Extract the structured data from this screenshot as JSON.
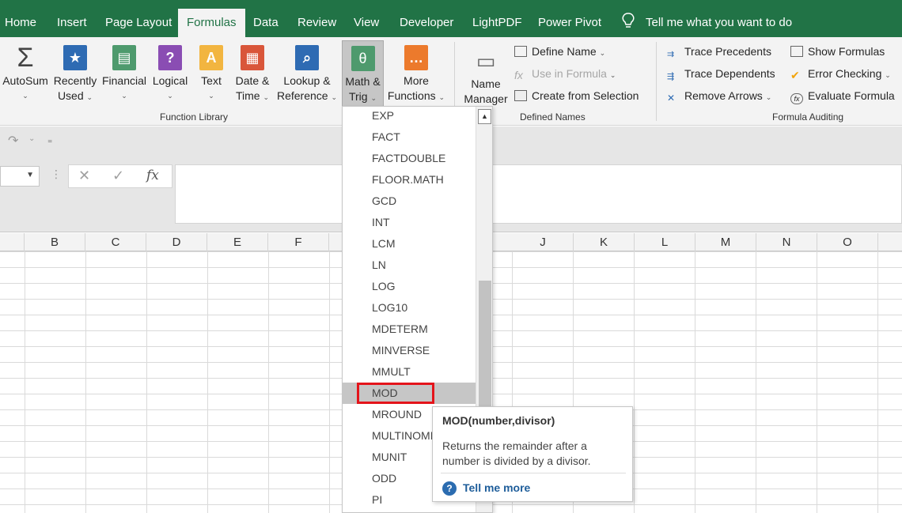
{
  "tabs": [
    "Home",
    "Insert",
    "Page Layout",
    "Formulas",
    "Data",
    "Review",
    "View",
    "Developer",
    "LightPDF",
    "Power Pivot"
  ],
  "tell_me": "Tell me what you want to do",
  "ribbon": {
    "autosum": "AutoSum",
    "recently_used": [
      "Recently",
      "Used"
    ],
    "financial": "Financial",
    "logical": "Logical",
    "text": "Text",
    "date_time": [
      "Date &",
      "Time"
    ],
    "lookup_reference": [
      "Lookup &",
      "Reference"
    ],
    "math_trig": [
      "Math &",
      "Trig"
    ],
    "more_functions": [
      "More",
      "Functions"
    ],
    "function_library_label": "Function Library",
    "name_manager": [
      "Name",
      "Manager"
    ],
    "define_name": "Define Name",
    "use_in_formula": "Use in Formula",
    "create_from_selection": "Create from Selection",
    "defined_names_label": "Defined Names",
    "trace_precedents": "Trace Precedents",
    "trace_dependents": "Trace Dependents",
    "remove_arrows": "Remove Arrows",
    "show_formulas": "Show Formulas",
    "error_checking": "Error Checking",
    "evaluate_formula": "Evaluate Formula",
    "formula_auditing_label": "Formula Auditing"
  },
  "columns": [
    "B",
    "C",
    "D",
    "E",
    "F",
    "J",
    "K",
    "L",
    "M",
    "N",
    "O"
  ],
  "dropdown_items": [
    "EXP",
    "FACT",
    "FACTDOUBLE",
    "FLOOR.MATH",
    "GCD",
    "INT",
    "LCM",
    "LN",
    "LOG",
    "LOG10",
    "MDETERM",
    "MINVERSE",
    "MMULT",
    "MOD",
    "MROUND",
    "MULTINOMIAL",
    "MUNIT",
    "ODD",
    "PI"
  ],
  "tooltip": {
    "title": "MOD(number,divisor)",
    "description": "Returns the remainder after a number is divided by a divisor.",
    "more": "Tell me more"
  },
  "colors": {
    "accent": "#217346",
    "highlight_box": "#e4141b"
  },
  "icons": [
    "sigma-icon",
    "star-book-icon",
    "financial-icon",
    "logical-icon",
    "text-icon",
    "date-icon",
    "lookup-icon",
    "theta-icon",
    "more-icon"
  ]
}
